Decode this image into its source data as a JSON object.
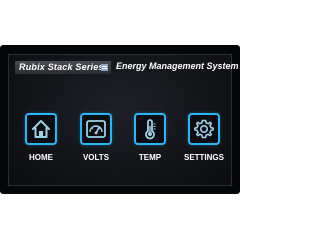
{
  "header": {
    "series_label": "Rubix Stack Series",
    "title": "Energy Management System"
  },
  "menu": [
    {
      "label": "HOME",
      "icon": "home-icon"
    },
    {
      "label": "VOLTS",
      "icon": "voltmeter-icon"
    },
    {
      "label": "TEMP",
      "icon": "thermometer-icon"
    },
    {
      "label": "SETTINGS",
      "icon": "gear-icon"
    }
  ],
  "colors": {
    "accent": "#29b6f6",
    "icon_fill": "#9ed0e6"
  }
}
